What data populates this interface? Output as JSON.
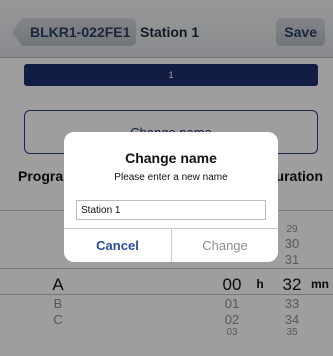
{
  "nav": {
    "back_label": "BLKR1-022FE1",
    "title": "Station 1",
    "save_label": "Save"
  },
  "station_bar": {
    "number": "1"
  },
  "change_name_button": {
    "label": "Change name"
  },
  "labels": {
    "program": "Program",
    "duration": "Duration"
  },
  "picker": {
    "programs": [
      "A",
      "B",
      "C"
    ],
    "hours_above": [],
    "hours": [
      "00",
      "01",
      "02",
      "03"
    ],
    "hours_unit": "h",
    "minutes_above": [
      "29",
      "30",
      "31"
    ],
    "minutes": [
      "32",
      "33",
      "34",
      "35"
    ],
    "minutes_unit": "mn"
  },
  "dialog": {
    "title": "Change name",
    "message": "Please enter a new name",
    "input_value": "Station 1",
    "cancel_label": "Cancel",
    "change_label": "Change"
  }
}
